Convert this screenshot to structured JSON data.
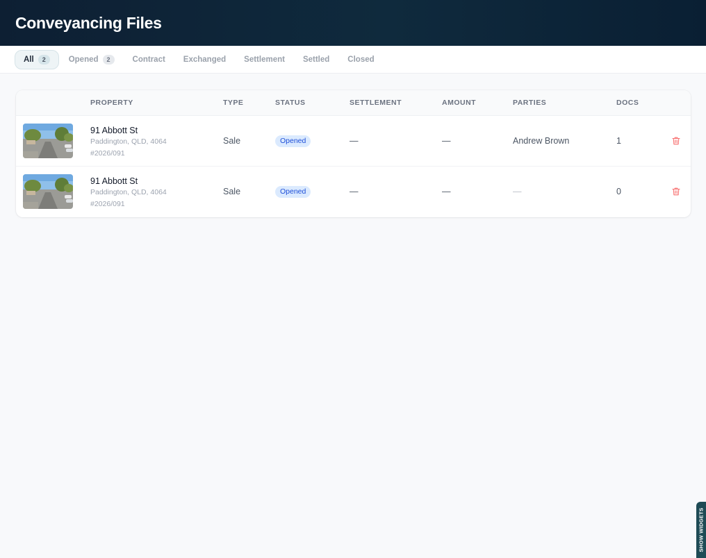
{
  "header": {
    "title": "Conveyancing Files"
  },
  "tabs": [
    {
      "label": "All",
      "count": "2",
      "active": true
    },
    {
      "label": "Opened",
      "count": "2",
      "active": false
    },
    {
      "label": "Contract",
      "count": "",
      "active": false
    },
    {
      "label": "Exchanged",
      "count": "",
      "active": false
    },
    {
      "label": "Settlement",
      "count": "",
      "active": false
    },
    {
      "label": "Settled",
      "count": "",
      "active": false
    },
    {
      "label": "Closed",
      "count": "",
      "active": false
    }
  ],
  "table": {
    "columns": [
      "Property",
      "Type",
      "Status",
      "Settlement",
      "Amount",
      "Parties",
      "Docs"
    ],
    "rows": [
      {
        "address": "91 Abbott St",
        "locality": "Paddington, QLD, 4064",
        "ref": "#2026/091",
        "type": "Sale",
        "status": "Opened",
        "settlement": "—",
        "amount": "—",
        "parties": "Andrew Brown",
        "docs": "1"
      },
      {
        "address": "91 Abbott St",
        "locality": "Paddington, QLD, 4064",
        "ref": "#2026/091",
        "type": "Sale",
        "status": "Opened",
        "settlement": "—",
        "amount": "—",
        "parties": "—",
        "docs": "0"
      }
    ]
  },
  "widgets_toggle": {
    "label": "SHOW WIDGETS"
  },
  "colors": {
    "header_bg": "#0d1f33",
    "status_badge_bg": "#dbeafe",
    "status_badge_text": "#1d4ed8",
    "delete_icon": "#f87171",
    "widgets_tab_bg": "#1e4b55"
  },
  "icons": {
    "delete": "trash-icon",
    "thumbnail": "street-view-photo"
  }
}
